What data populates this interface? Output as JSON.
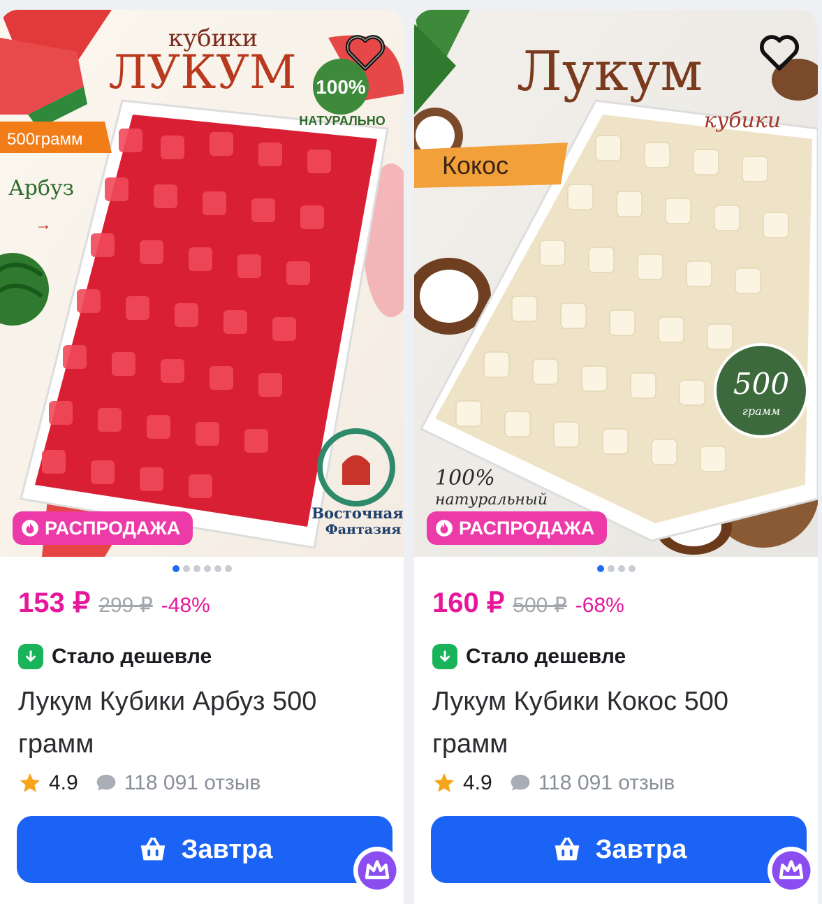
{
  "products": [
    {
      "image": {
        "brand_small": "кубики",
        "brand_big": "ЛУКУМ",
        "badge_weight": "500грамм",
        "flavor": "Арбуз",
        "natural": "100%",
        "natural_sub": "НАТУРАЛЬНО",
        "maker_line1": "Восточная",
        "maker_line2": "Фантазия"
      },
      "sale_label": "РАСПРОДАЖА",
      "dots": 6,
      "active_dot": 0,
      "price": "153 ₽",
      "old_price": "299 ₽",
      "discount": "-48%",
      "cheaper": "Стало дешевле",
      "title": "Лукум Кубики Арбуз 500 грамм",
      "rating": "4.9",
      "reviews": "118 091 отзыв",
      "delivery": "Завтра"
    },
    {
      "image": {
        "brand_small": "кубики",
        "brand_big": "Лукум",
        "flavor": "Кокос",
        "weight": "500",
        "weight_unit": "грамм",
        "natural": "100%",
        "natural_sub": "натуральный"
      },
      "sale_label": "РАСПРОДАЖА",
      "dots": 4,
      "active_dot": 0,
      "price": "160 ₽",
      "old_price": "500 ₽",
      "discount": "-68%",
      "cheaper": "Стало дешевле",
      "title": "Лукум Кубики Кокос 500 грамм",
      "rating": "4.9",
      "reviews": "118 091 отзыв",
      "delivery": "Завтра"
    }
  ],
  "colors": {
    "accent_pink": "#e5179a",
    "sale_badge": "#ec3aa8",
    "button_blue": "#1b63f4",
    "cheaper_green": "#19b35a"
  }
}
